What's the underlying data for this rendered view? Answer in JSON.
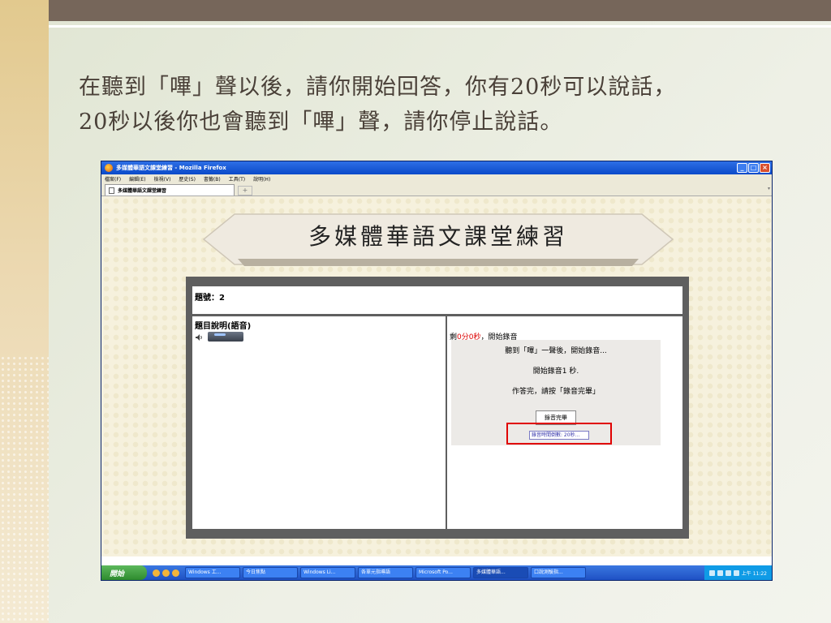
{
  "slide": {
    "heading_line1": "在聽到「嗶」聲以後，請你開始回答，你有20秒可以說話，",
    "heading_line2": "20秒以後你也會聽到「嗶」聲，請你停止說話。"
  },
  "browser": {
    "title": "多媒體華語文課堂練習 - Mozilla Firefox",
    "menu": [
      "檔案(F)",
      "編輯(E)",
      "檢視(V)",
      "歷史(S)",
      "書籤(B)",
      "工具(T)",
      "說明(H)"
    ],
    "tab_label": "多媒體華語文課堂練習",
    "new_tab": "+"
  },
  "page": {
    "banner_title": "多媒體華語文課堂練習",
    "question_number": "題號：2",
    "description_label": "題目說明(語音)",
    "remaining_prefix": "剩",
    "remaining_time": "0分0秒",
    "remaining_suffix": "，開始錄音",
    "instruction1": "聽到「嗶」一聲後，開始錄音...",
    "instruction2": "開始錄音1 秒.",
    "instruction3": "作答完，請按「錄音完畢」",
    "record_done_button": "錄音完畢",
    "record_time_field": "錄音時間倒數: 20秒..."
  },
  "taskbar": {
    "start": "開始",
    "tasks": [
      "Windows 工...",
      "今日焦點",
      "Windows Li...",
      "各單元指導語",
      "Microsoft Po...",
      "多媒體華語...",
      "口說測驗指..."
    ],
    "clock": "上午 11:22"
  },
  "colors": {
    "top_bar": "#76665a",
    "highlight_box": "#e00000",
    "remaining_time": "#dd0000"
  }
}
